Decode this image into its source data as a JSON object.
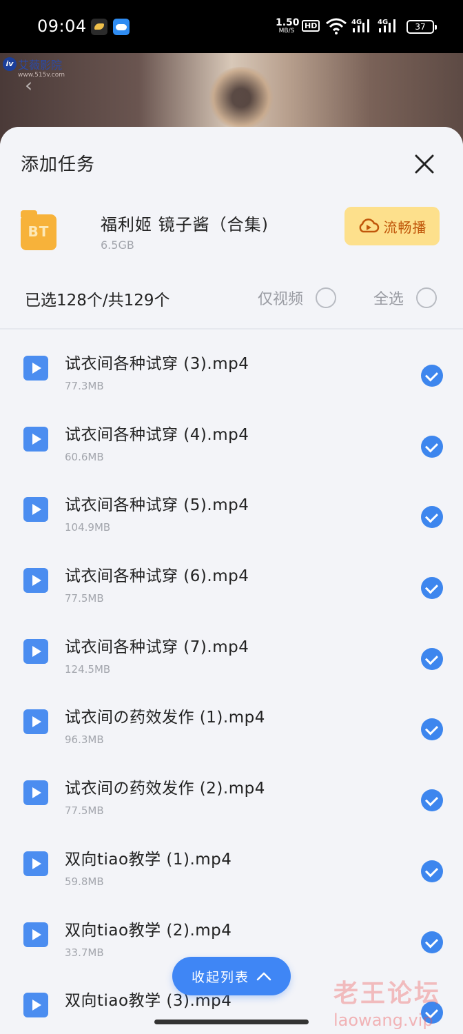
{
  "status_bar": {
    "time": "09:04",
    "net_speed_value": "1.50",
    "net_speed_unit": "MB/S",
    "hd_label": "HD",
    "signal_1": "4G",
    "signal_2": "4G",
    "battery": "37",
    "app_icons": [
      "bird-app-icon",
      "weather-app-icon"
    ]
  },
  "background": {
    "logo_text": "艾薇影院",
    "logo_mark": "iv",
    "logo_sub": "www.515v.com"
  },
  "sheet": {
    "title": "添加任务",
    "torrent": {
      "badge": "BT",
      "name": "福利姬 镜子酱（合集)",
      "size": "6.5GB",
      "stream_button": "流畅播"
    },
    "selection_text": "已选128个/共129个",
    "video_only_label": "仅视频",
    "select_all_label": "全选",
    "files": [
      {
        "name": "试衣间各种试穿 (3).mp4",
        "size": "77.3MB",
        "checked": true
      },
      {
        "name": "试衣间各种试穿 (4).mp4",
        "size": "60.6MB",
        "checked": true
      },
      {
        "name": "试衣间各种试穿 (5).mp4",
        "size": "104.9MB",
        "checked": true
      },
      {
        "name": "试衣间各种试穿 (6).mp4",
        "size": "77.5MB",
        "checked": true
      },
      {
        "name": "试衣间各种试穿 (7).mp4",
        "size": "124.5MB",
        "checked": true
      },
      {
        "name": "试衣间の药效发作 (1).mp4",
        "size": "96.3MB",
        "checked": true
      },
      {
        "name": "试衣间の药效发作 (2).mp4",
        "size": "77.5MB",
        "checked": true
      },
      {
        "name": "双向tiao教学 (1).mp4",
        "size": "59.8MB",
        "checked": true
      },
      {
        "name": "双向tiao教学 (2).mp4",
        "size": "33.7MB",
        "checked": true
      },
      {
        "name": "双向tiao教学 (3).mp4",
        "size": "",
        "checked": true
      }
    ],
    "collapse_button": "收起列表"
  },
  "watermark": {
    "line1": "老王论坛",
    "line2": "laowang.vip"
  },
  "colors": {
    "accent": "#3d86ee",
    "bt_orange": "#f7b23a",
    "stream_bg": "#fde08c",
    "stream_text": "#c0560a",
    "sheet_bg": "#f3f4f8"
  }
}
